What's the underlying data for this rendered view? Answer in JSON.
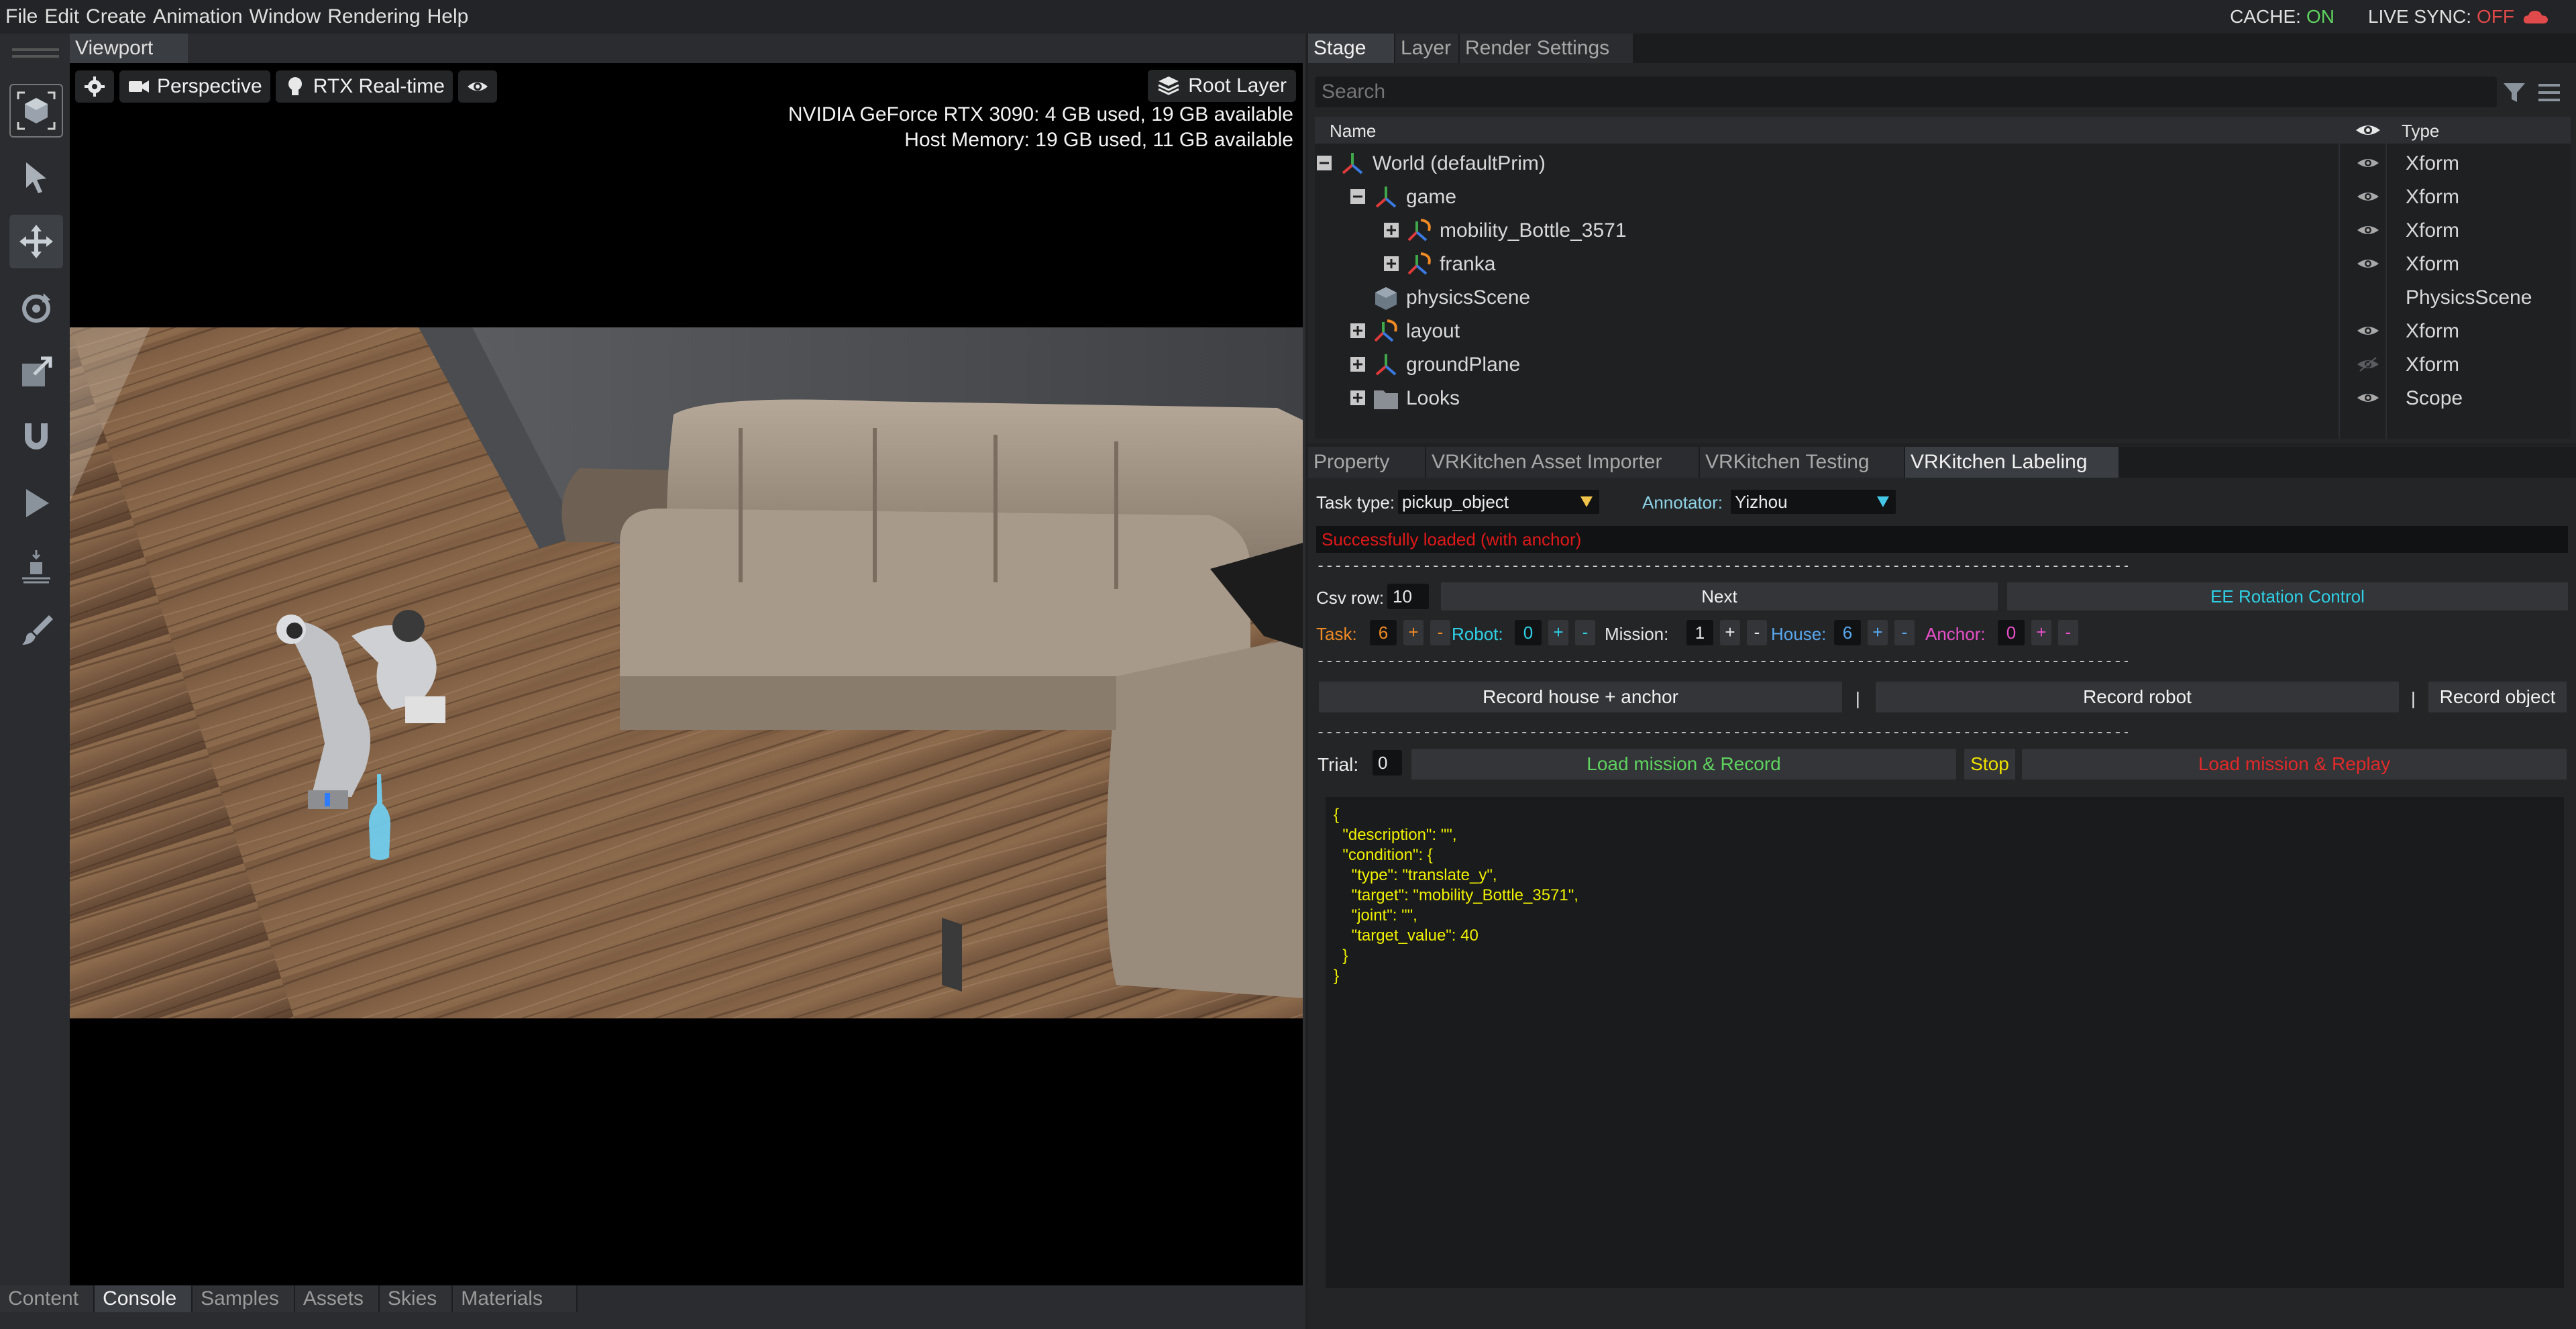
{
  "menu": [
    "File",
    "Edit",
    "Create",
    "Animation",
    "Window",
    "Rendering",
    "Help"
  ],
  "status": {
    "cache_label": "CACHE:",
    "cache_value": "ON",
    "live_sync_label": "LIVE SYNC:",
    "live_sync_value": "OFF",
    "cache_color": "#5fd35f",
    "live_sync_color": "#e04a4a"
  },
  "toolbar": {
    "tools": [
      "select-mode-icon",
      "select-arrow-icon",
      "move-icon",
      "rotate-icon",
      "scale-icon",
      "snap-magnet-icon",
      "play-icon",
      "physics-icon",
      "paint-brush-icon"
    ],
    "active_tool": "move-icon"
  },
  "viewport": {
    "tab_label": "Viewport",
    "camera_label": "Perspective",
    "renderer_label": "RTX Real-time",
    "layer_label": "Root Layer",
    "gpu_line": "NVIDIA GeForce RTX 3090: 4 GB used,  19 GB available",
    "host_line": "Host Memory: 19 GB used, 11 GB available"
  },
  "bottom_tabs": [
    "Content",
    "Console",
    "Samples",
    "Assets",
    "Skies",
    "Materials"
  ],
  "bottom_active": "Console",
  "stage": {
    "tabs": [
      "Stage",
      "Layer",
      "Render Settings"
    ],
    "active_tab": "Stage",
    "search_placeholder": "Search",
    "header_name": "Name",
    "header_type": "Type",
    "rows": [
      {
        "name": "World (defaultPrim)",
        "type": "Xform",
        "depth": 0,
        "expander": "minus",
        "icon": "xform-axes-icon",
        "visible": true
      },
      {
        "name": "game",
        "type": "Xform",
        "depth": 1,
        "expander": "minus",
        "icon": "xform-axes-icon",
        "visible": true
      },
      {
        "name": "mobility_Bottle_3571",
        "type": "Xform",
        "depth": 2,
        "expander": "plus",
        "icon": "instance-axes-icon",
        "visible": true
      },
      {
        "name": "franka",
        "type": "Xform",
        "depth": 2,
        "expander": "plus",
        "icon": "instance-axes-icon",
        "visible": true
      },
      {
        "name": "physicsScene",
        "type": "PhysicsScene",
        "depth": 1,
        "expander": "none",
        "icon": "physics-cube-icon",
        "visible": false
      },
      {
        "name": "layout",
        "type": "Xform",
        "depth": 1,
        "expander": "plus",
        "icon": "instance-axes-icon",
        "visible": true
      },
      {
        "name": "groundPlane",
        "type": "Xform",
        "depth": 1,
        "expander": "plus",
        "icon": "xform-axes-icon",
        "visible": "hidden"
      },
      {
        "name": "Looks",
        "type": "Scope",
        "depth": 1,
        "expander": "plus",
        "icon": "folder-icon",
        "visible": true
      }
    ]
  },
  "lower": {
    "tabs": [
      "Property",
      "VRKitchen Asset Importer",
      "VRKitchen Testing",
      "VRKitchen Labeling"
    ],
    "active_tab": "VRKitchen Labeling",
    "task_type_label": "Task type:",
    "task_type_value": "pickup_object",
    "annotator_label": "Annotator:",
    "annotator_value": "Yizhou",
    "status_message": "Successfully loaded (with anchor)",
    "dashes": "------------------------------------------------------------------------------------------------------------------------------------------------------------------------------------------------",
    "csv_label": "Csv row:",
    "csv_value": "10",
    "next_label": "Next",
    "ee_label": "EE Rotation Control",
    "counters": [
      {
        "label": "Task:",
        "value": "6",
        "color": "#f08a24"
      },
      {
        "label": "Robot:",
        "value": "0",
        "color": "#2fd0e6"
      },
      {
        "label": "Mission:",
        "value": "1",
        "color": "#e6e6e6"
      },
      {
        "label": "House:",
        "value": "6",
        "color": "#5aa8f0"
      },
      {
        "label": "Anchor:",
        "value": "0",
        "color": "#e650c8"
      }
    ],
    "plus": "+",
    "minus": "-",
    "record_house_label": "Record house + anchor",
    "record_robot_label": "Record robot",
    "record_object_label": "Record object",
    "pipe": "|",
    "trial_label": "Trial:",
    "trial_value": "0",
    "load_record_label": "Load mission & Record",
    "stop_label": "Stop",
    "load_replay_label": "Load mission & Replay",
    "json_text": "{\n  \"description\": \"\",\n  \"condition\": {\n    \"type\": \"translate_y\",\n    \"target\": \"mobility_Bottle_3571\",\n    \"joint\": \"\",\n    \"target_value\": 40\n  }\n}"
  }
}
